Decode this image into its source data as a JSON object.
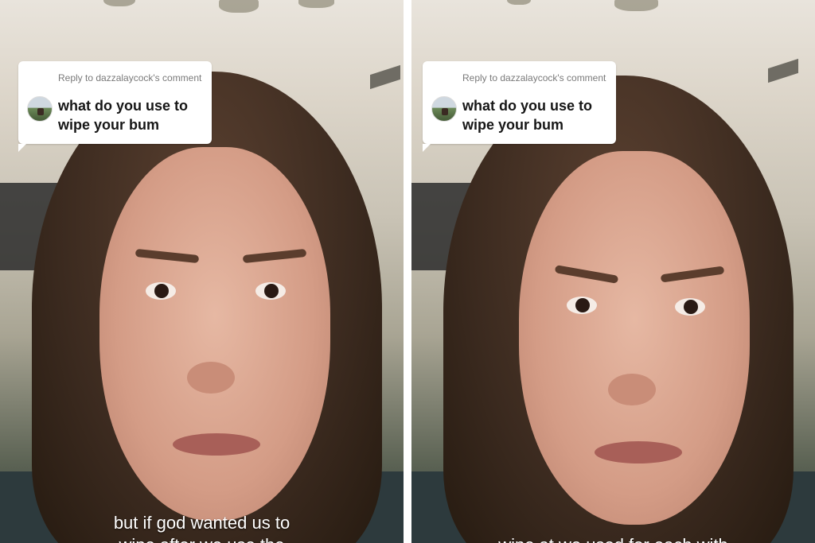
{
  "left_panel": {
    "reply_label": "Reply to dazzalaycock's comment",
    "comment_text": "what do you use to wipe your bum",
    "caption_line1": "but if god wanted us to",
    "caption_line2": "wipe after we use the"
  },
  "right_panel": {
    "reply_label": "Reply to dazzalaycock's comment",
    "comment_text": "what do you use to wipe your bum",
    "caption_line2": "wipe at we used for each with"
  }
}
